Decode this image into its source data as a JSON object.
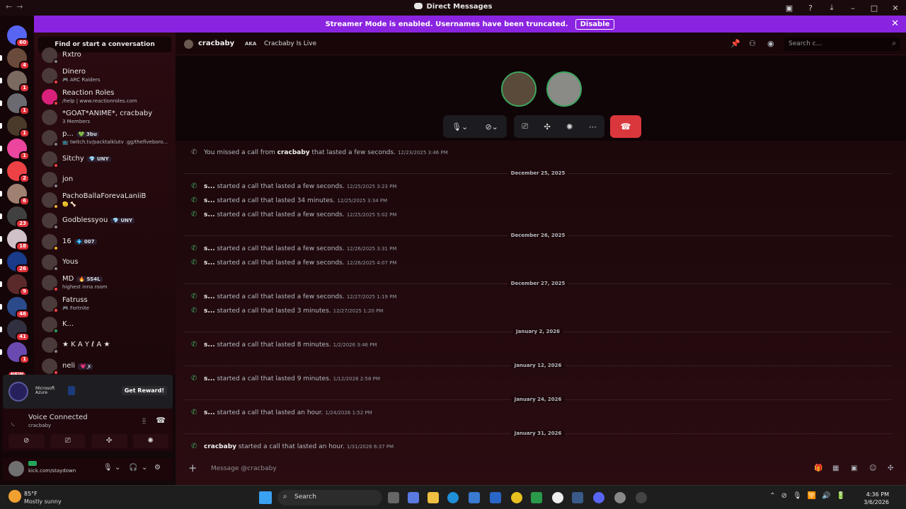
{
  "window": {
    "title": "Direct Messages"
  },
  "banner": {
    "text": "Streamer Mode is enabled. Usernames have been truncated.",
    "disable_label": "Disable"
  },
  "servers": [
    {
      "badge": "60"
    },
    {
      "badge": "4"
    },
    {
      "badge": "1"
    },
    {
      "badge": "1"
    },
    {
      "badge": "1"
    },
    {
      "badge": "1"
    },
    {
      "badge": "2"
    },
    {
      "badge": "6"
    },
    {
      "badge": "23"
    },
    {
      "badge": "18"
    },
    {
      "badge": "26"
    },
    {
      "badge": "9"
    },
    {
      "badge": "46"
    },
    {
      "badge": "41"
    },
    {
      "badge": "1"
    },
    {
      "badge": "NEW"
    }
  ],
  "sidebar": {
    "find_label": "Find or start a conversation",
    "dms": [
      {
        "name": "Rxtro",
        "sub": ""
      },
      {
        "name": "Dinero",
        "sub": "🎮 ARC Raiders"
      },
      {
        "name": "Reaction Roles",
        "sub": "/help | www.reactionroles.com"
      },
      {
        "name": "*GOAT*ANIME*, cracbaby",
        "sub": "3 Members"
      },
      {
        "name": "p...",
        "tag": "💚 3bu",
        "sub": "📺 twitch.tv/packtalklutv .gg/thefiveboro..."
      },
      {
        "name": "Sitchy",
        "tag": "💎 UNY",
        "sub": ""
      },
      {
        "name": "jon",
        "sub": ""
      },
      {
        "name": "PachoBallaForevaLaniiB",
        "sub": "🫡 🦴"
      },
      {
        "name": "Godblessyou",
        "tag": "💎 UNY",
        "sub": ""
      },
      {
        "name": "16",
        "tag": "💠 007",
        "sub": ""
      },
      {
        "name": "Yous",
        "sub": ""
      },
      {
        "name": "MD",
        "tag": "🔥 SS4L",
        "sub": "highest inna room"
      },
      {
        "name": "Fatruss",
        "sub": "🎮 Fortnite"
      },
      {
        "name": "K...",
        "sub": ""
      },
      {
        "name": "★ K A Y ℓ A ★",
        "sub": ""
      },
      {
        "name": "neli",
        "tag": "💗 ꭗ",
        "sub": ""
      }
    ]
  },
  "promo": {
    "sponsor_line1": "Microsoft",
    "sponsor_line2": "Azure",
    "reward_label": "Get Reward!"
  },
  "voice": {
    "status": "Voice Connected",
    "channel": "cracbaby"
  },
  "user": {
    "status": "kick.com/staydown"
  },
  "channel": {
    "name": "cracbaby",
    "aka_label": "AKA",
    "aka_value": "Cracbaby Is Live",
    "search_placeholder": "Search c..."
  },
  "messages": [
    {
      "type": "msg",
      "miss": true,
      "pre": "You missed a call from ",
      "who": "cracbaby",
      "post": " that lasted a few seconds.",
      "ts": "12/23/2025 3:46 PM"
    },
    {
      "type": "divider",
      "label": "December 25, 2025"
    },
    {
      "type": "msg",
      "who": "s...",
      "post": " started a call that lasted a few seconds.",
      "ts": "12/25/2025 3:23 PM"
    },
    {
      "type": "msg",
      "who": "s...",
      "post": " started a call that lasted 34 minutes.",
      "ts": "12/25/2025 3:34 PM"
    },
    {
      "type": "msg",
      "who": "s...",
      "post": " started a call that lasted a few seconds.",
      "ts": "12/25/2025 5:02 PM"
    },
    {
      "type": "divider",
      "label": "December 26, 2025"
    },
    {
      "type": "msg",
      "who": "s...",
      "post": " started a call that lasted a few seconds.",
      "ts": "12/26/2025 3:31 PM"
    },
    {
      "type": "msg",
      "who": "s...",
      "post": " started a call that lasted a few seconds.",
      "ts": "12/26/2025 4:07 PM"
    },
    {
      "type": "divider",
      "label": "December 27, 2025"
    },
    {
      "type": "msg",
      "who": "s...",
      "post": " started a call that lasted a few seconds.",
      "ts": "12/27/2025 1:19 PM"
    },
    {
      "type": "msg",
      "who": "s...",
      "post": " started a call that lasted 3 minutes.",
      "ts": "12/27/2025 1:20 PM"
    },
    {
      "type": "divider",
      "label": "January 2, 2026"
    },
    {
      "type": "msg",
      "who": "s...",
      "post": " started a call that lasted 8 minutes.",
      "ts": "1/2/2026 3:46 PM"
    },
    {
      "type": "divider",
      "label": "January 12, 2026"
    },
    {
      "type": "msg",
      "who": "s...",
      "post": " started a call that lasted 9 minutes.",
      "ts": "1/12/2026 2:58 PM"
    },
    {
      "type": "divider",
      "label": "January 24, 2026"
    },
    {
      "type": "msg",
      "who": "s...",
      "post": " started a call that lasted an hour.",
      "ts": "1/24/2026 1:52 PM"
    },
    {
      "type": "divider",
      "label": "January 31, 2026"
    },
    {
      "type": "msg",
      "who": "cracbaby",
      "post": " started a call that lasted an hour.",
      "ts": "1/31/2026 6:37 PM"
    }
  ],
  "composer": {
    "placeholder": "Message @cracbaby"
  },
  "taskbar": {
    "temp": "85°F",
    "weather": "Mostly sunny",
    "search": "Search",
    "time": "4:36 PM",
    "date": "3/6/2026"
  }
}
